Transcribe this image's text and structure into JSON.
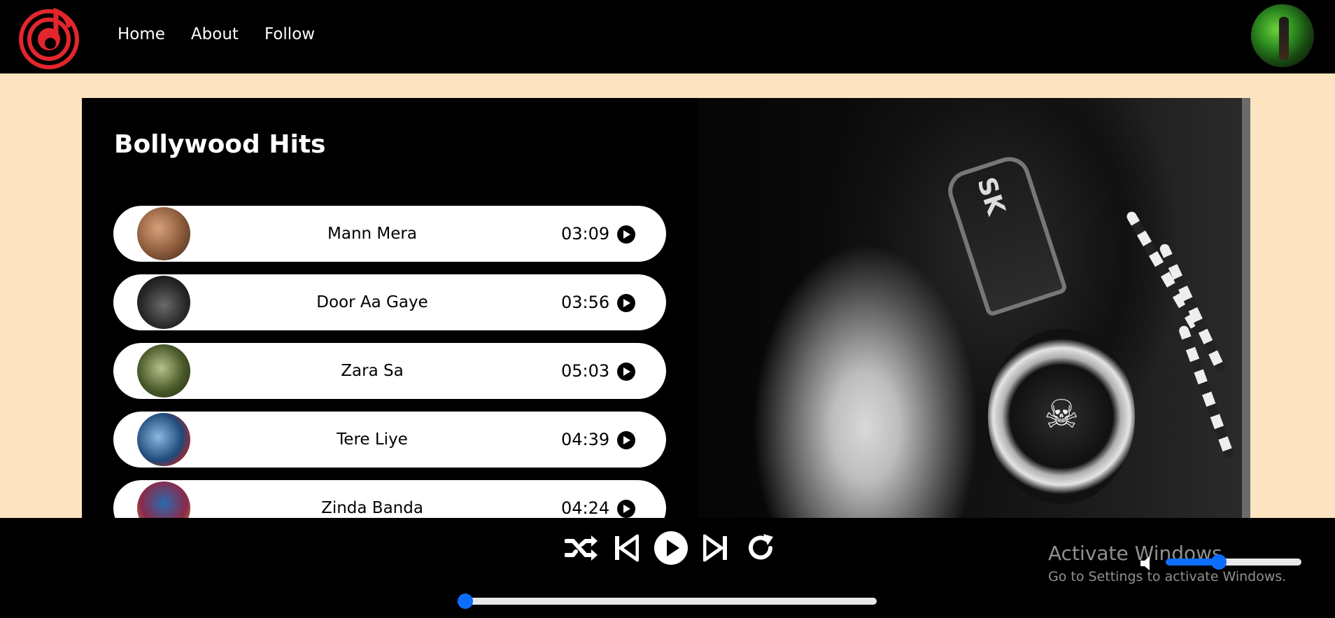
{
  "nav": {
    "logo_icon": "music-note-logo-icon",
    "links": [
      {
        "label": "Home"
      },
      {
        "label": "About"
      },
      {
        "label": "Follow"
      }
    ],
    "avatar_icon": "user-avatar"
  },
  "playlist": {
    "title": "Bollywood Hits",
    "songs": [
      {
        "name": "Mann Mera",
        "duration": "03:09",
        "cover_color": "#8a5a3a"
      },
      {
        "name": "Door Aa Gaye",
        "duration": "03:56",
        "cover_color": "#2a2a2a"
      },
      {
        "name": "Zara Sa",
        "duration": "05:03",
        "cover_color": "#4a5a2a"
      },
      {
        "name": "Tere Liye",
        "duration": "04:39",
        "cover_color": "#1e4a7a"
      },
      {
        "name": "Zinda Banda",
        "duration": "04:24",
        "cover_color": "#8a2a4a"
      }
    ]
  },
  "player": {
    "controls": [
      "shuffle-icon",
      "previous-icon",
      "play-icon",
      "next-icon",
      "repeat-icon"
    ],
    "progress_fraction": 0.0,
    "volume_fraction": 0.4
  },
  "watermark": {
    "title": "Activate Windows",
    "subtitle": "Go to Settings to activate Windows."
  },
  "colors": {
    "accent": "#e3262d",
    "page_background": "#fde4c0",
    "slider_blue": "#0d6efd"
  }
}
